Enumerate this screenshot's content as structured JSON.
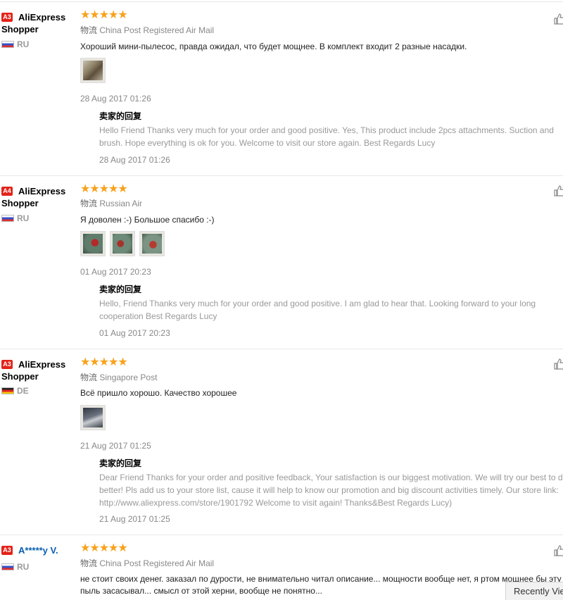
{
  "recently_viewed_label": "Recently Vie",
  "star_glyphs": "★★★★★",
  "reply_title": "卖家的回复",
  "logistics_label": "物流",
  "colors": {
    "star": "#f7a21b",
    "badge": "#e2231a",
    "masked_user": "#0a5fb0"
  },
  "reviews": [
    {
      "badge": "A3",
      "user": "AliExpress Shopper",
      "country": "RU",
      "rating": 5,
      "logistics": "China Post Registered Air Mail",
      "text": "Хороший мини-пылесос, правда ожидал, что будет мощнее. В комплект входит 2 разные насадки.",
      "photo_count": 1,
      "date": "28 Aug 2017 01:26",
      "reply": {
        "text": "Hello Friend Thanks very much for your order and good positive. Yes, This product include 2pcs attachments. Suction and brush. Hope everything is ok for you. Welcome to visit our store again. Best Regards Lucy",
        "date": "28 Aug 2017 01:26"
      }
    },
    {
      "badge": "A4",
      "user": "AliExpress Shopper",
      "country": "RU",
      "rating": 5,
      "logistics": "Russian Air",
      "text": "Я доволен :-) Большое спасибо :-)",
      "photo_count": 3,
      "date": "01 Aug 2017 20:23",
      "reply": {
        "text": "Hello, Friend Thanks very much for your order and good positive. I am glad to hear that. Looking forward to your long cooperation Best Regards Lucy",
        "date": "01 Aug 2017 20:23"
      }
    },
    {
      "badge": "A3",
      "user": "AliExpress Shopper",
      "country": "DE",
      "rating": 5,
      "logistics": "Singapore Post",
      "text": "Всё пришло хорошо. Качество хорошее",
      "photo_count": 1,
      "date": "21 Aug 2017 01:25",
      "reply": {
        "text": "Dear Friend Thanks for your order and positive feedback, Your satisfaction is our biggest motivation. We will try our best to do better! Pls add us to your store list, cause it will help to know our promotion and big discount activities timely. Our store link: http://www.aliexpress.com/store/1901792 Welcome to visit again! Thanks&Best Regards Lucy)",
        "date": "21 Aug 2017 01:25"
      }
    },
    {
      "badge": "A3",
      "user": "A*****y V.",
      "country": "RU",
      "rating": 5,
      "logistics": "China Post Registered Air Mail",
      "text_line1": "не стоит своих денег. заказал по дурости, не внимательно читал описание... мощности вообще нет, я ртом мощнее бы эту",
      "text_line2": "пыль засасывал... смысл от этой херни, вообще не понятно..."
    }
  ]
}
